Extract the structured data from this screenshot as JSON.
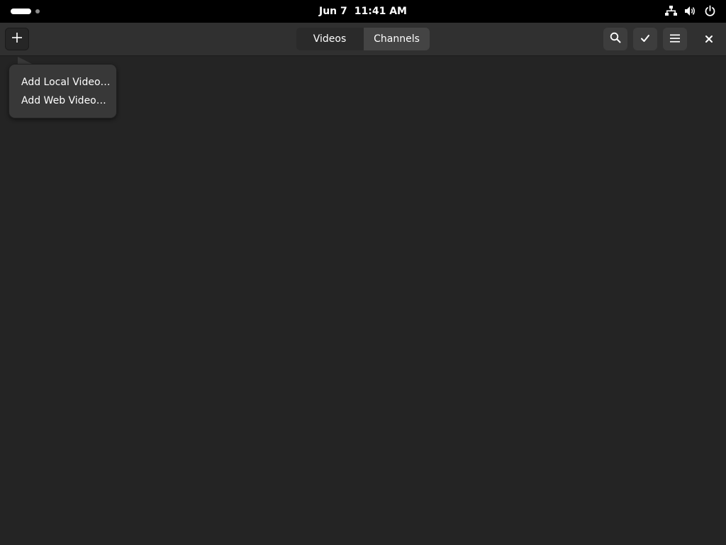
{
  "system_bar": {
    "date": "Jun 7",
    "time": "11:41 AM",
    "icons": [
      "network-wired-icon",
      "volume-icon",
      "power-icon"
    ]
  },
  "header": {
    "add_button_icon": "plus-icon",
    "view_switcher": [
      {
        "label": "Videos",
        "active": true
      },
      {
        "label": "Channels",
        "active": false
      }
    ],
    "search_button_icon": "search-icon",
    "select_button_icon": "checkmark-icon",
    "menu_button_icon": "hamburger-menu-icon",
    "close_button_icon": "close-icon"
  },
  "add_popover": {
    "items": [
      {
        "label": "Add Local Video…"
      },
      {
        "label": "Add Web Video…"
      }
    ]
  },
  "colors": {
    "top_bar": "#000000",
    "header_bar": "#303030",
    "window_bg": "#242424",
    "popover_bg": "#383838"
  }
}
